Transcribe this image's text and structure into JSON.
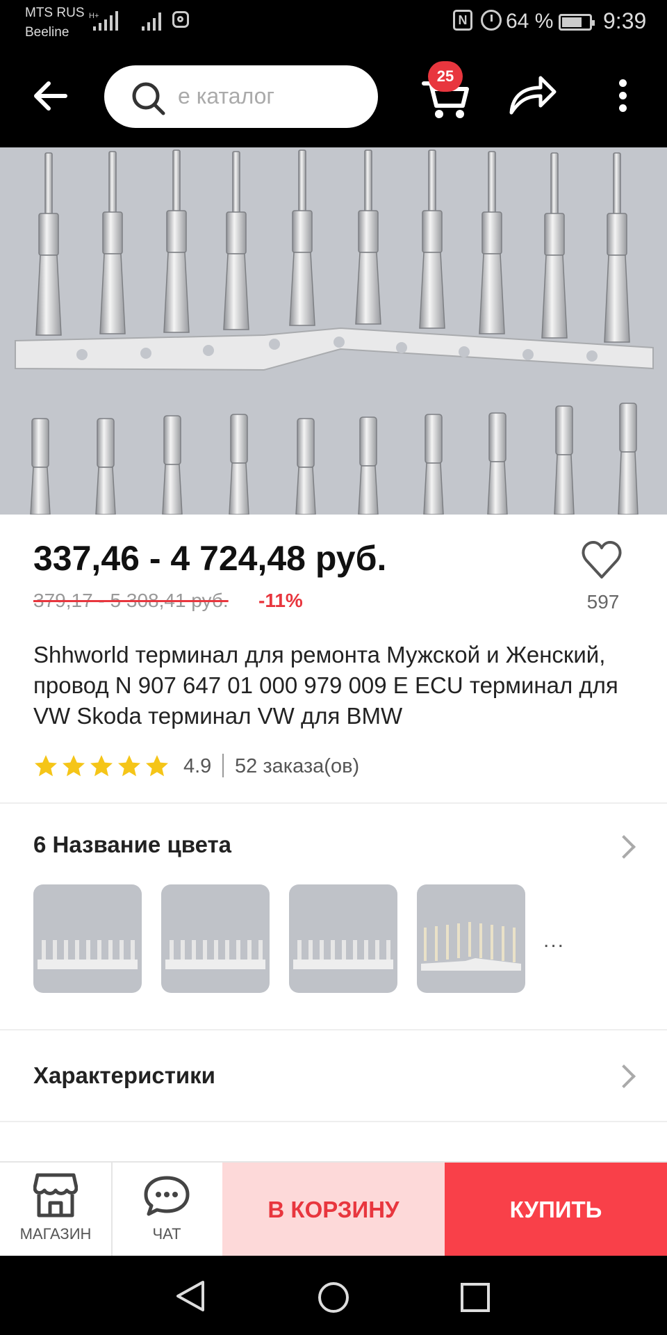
{
  "status_bar": {
    "carrier_primary": "MTS RUS",
    "carrier_secondary": "Beeline",
    "network_type": "H+",
    "battery_percent": "64 %",
    "time": "9:39"
  },
  "top_nav": {
    "search_placeholder": "е каталог",
    "cart_count": "25"
  },
  "product": {
    "price": "337,46 - 4 724,48 руб.",
    "old_price": "379,17 - 5 308,41 руб.",
    "discount": "-11%",
    "wishlist_count": "597",
    "title": "Shhworld терминал для ремонта Мужской и Женский, провод N 907 647 01 000 979 009 E ECU терминал для VW Skoda терминал VW для BMW",
    "rating": "4.9",
    "orders": "52 заказа(ов)",
    "stars": 5
  },
  "color_section": {
    "title": "6 Название цвета",
    "more": "..."
  },
  "specs_section": {
    "title": "Характеристики"
  },
  "action_bar": {
    "shop_label": "МАГАЗИН",
    "chat_label": "ЧАТ",
    "add_to_cart_label": "В КОРЗИНУ",
    "buy_label": "КУПИТЬ"
  },
  "colors": {
    "accent": "#e8363e",
    "buy_button": "#f94049",
    "cart_button_bg": "#fdd9d9",
    "star": "#f5c518"
  },
  "icons": [
    "back-arrow-icon",
    "search-icon",
    "cart-icon",
    "share-icon",
    "more-icon",
    "heart-icon",
    "star-icon",
    "chevron-right-icon",
    "store-icon",
    "chat-icon",
    "nav-back-icon",
    "nav-home-icon",
    "nav-recents-icon"
  ]
}
